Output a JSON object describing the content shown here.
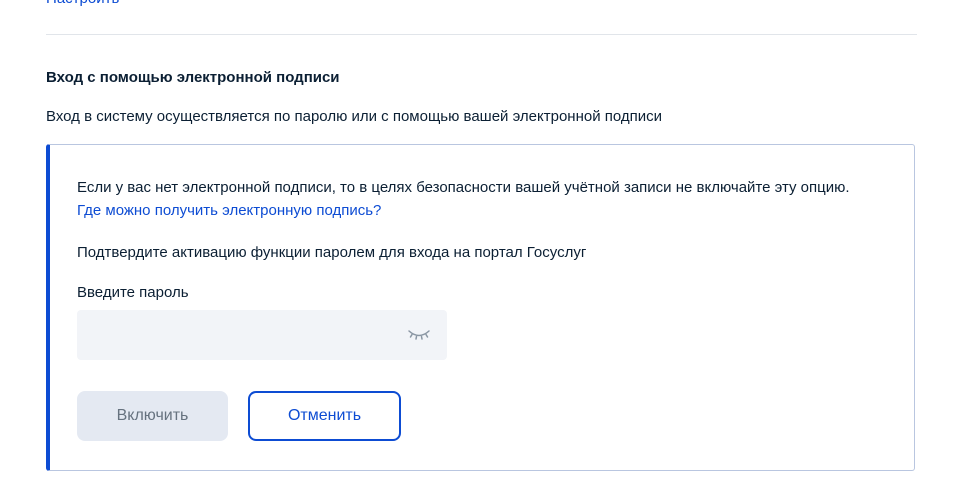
{
  "top": {
    "link_label": "Настроить"
  },
  "section": {
    "title": "Вход с помощью электронной подписи",
    "description": "Вход в систему осуществляется по паролю или с помощью вашей электронной подписи"
  },
  "card": {
    "warning_text": "Если у вас нет электронной подписи, то в целях безопасности вашей учётной записи не включайте эту опцию.",
    "help_link": "Где можно получить электронную подпись?",
    "confirm_text": "Подтвердите активацию функции паролем для входа на портал Госуслуг",
    "password_label": "Введите пароль",
    "password_value": "",
    "password_placeholder": "",
    "eye_icon": "eye-closed-icon",
    "enable_button": "Включить",
    "cancel_button": "Отменить"
  },
  "colors": {
    "accent": "#0d4cd3",
    "text": "#0b1f33",
    "disabled_bg": "#e4e9f2",
    "field_bg": "#f2f4f8"
  }
}
